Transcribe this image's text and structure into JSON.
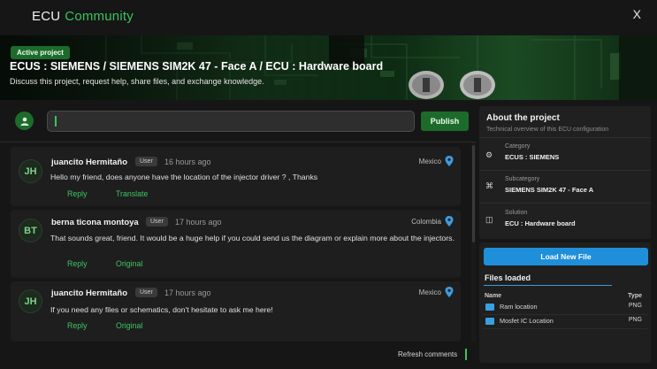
{
  "app": {
    "brand_main": "ECU",
    "brand_accent": "Community",
    "close_label": "X"
  },
  "banner": {
    "badge": "Active project",
    "title": "ECUS : SIEMENS / SIEMENS SIM2K 47 - Face A / ECU : Hardware board",
    "subtitle": "Discuss this project, request help, share files, and exchange knowledge."
  },
  "composer": {
    "input_value": "",
    "publish_label": "Publish"
  },
  "comments": [
    {
      "initials": "JH",
      "author": "juancito Hermitaño",
      "role": "User",
      "time": "16 hours ago",
      "country": "Mexico",
      "text": "Hello my friend, does anyone have the location of the injector driver ? , Thanks",
      "actions": [
        "Reply",
        "Translate"
      ]
    },
    {
      "initials": "BT",
      "author": "berna ticona montoya",
      "role": "User",
      "time": "17 hours ago",
      "country": "Colombia",
      "text": "That sounds great, friend. It would be a huge help if you could send us the diagram or explain more about the injectors.",
      "actions": [
        "Reply",
        "Original"
      ]
    },
    {
      "initials": "JH",
      "author": "juancito Hermitaño",
      "role": "User",
      "time": "17 hours ago",
      "country": "Mexico",
      "text": "If you need any files or schematics, don't hesitate to ask me here!",
      "actions": [
        "Reply",
        "Original"
      ]
    }
  ],
  "feed": {
    "refresh_label": "Refresh comments"
  },
  "about": {
    "title": "About the project",
    "subtitle": "Technical overview of this ECU configuration",
    "rows": [
      {
        "icon": "gear-icon",
        "label": "Category",
        "value": "ECUS : SIEMENS"
      },
      {
        "icon": "command-icon",
        "label": "Subcategory",
        "value": "SIEMENS SIM2K 47 - Face A"
      },
      {
        "icon": "board-icon",
        "label": "Solution",
        "value": "ECU : Hardware board"
      }
    ]
  },
  "files": {
    "load_label": "Load New File",
    "title": "Files loaded",
    "col_name": "Name",
    "col_type": "Type",
    "items": [
      {
        "name": "Ram location",
        "type": "PNG"
      },
      {
        "name": "Mosfet IC Location",
        "type": "PNG"
      }
    ]
  },
  "colors": {
    "accent_green": "#37c45f",
    "button_green": "#1c6b2b",
    "button_blue": "#1f8fd9",
    "background": "#161616"
  }
}
